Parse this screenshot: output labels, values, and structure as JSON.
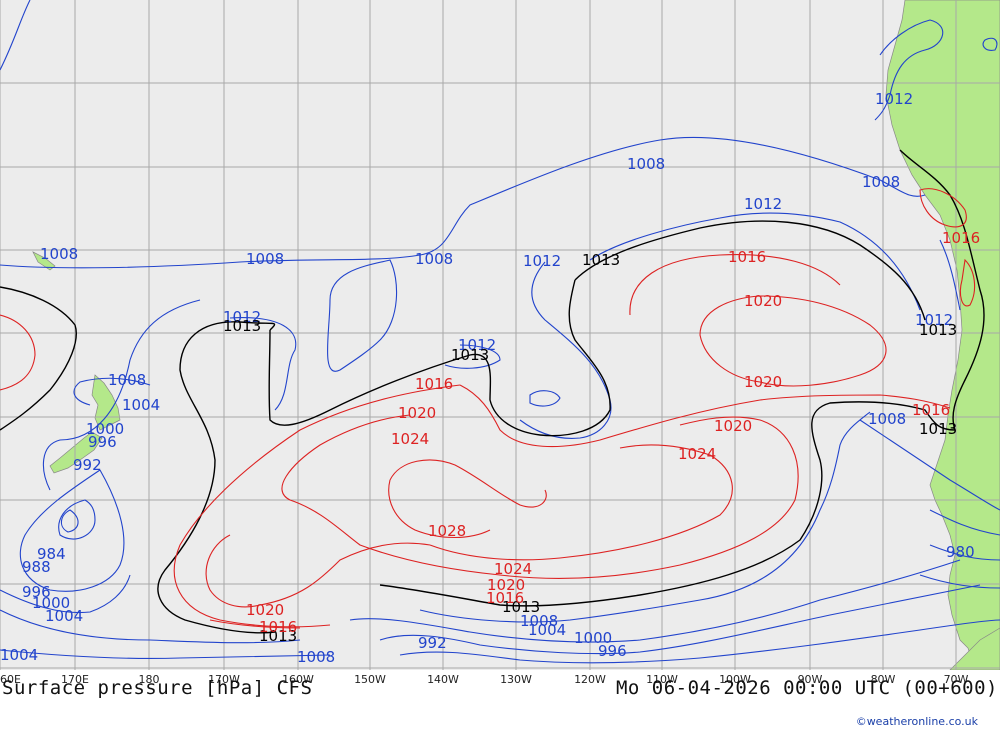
{
  "footer": {
    "title_left": "Surface pressure [hPa] CFS",
    "title_right": "Mo 06-04-2026 00:00 UTC (00+600)",
    "credit": "©weatheronline.co.uk"
  },
  "longitude_labels": [
    "60E",
    "170E",
    "180",
    "170W",
    "160W",
    "150W",
    "140W",
    "130W",
    "120W",
    "110W",
    "100W",
    "90W",
    "80W",
    "70W"
  ],
  "isobar_labels": {
    "blue": [
      "1008",
      "1008",
      "1008",
      "1008",
      "1008",
      "1008",
      "1008",
      "1008",
      "1008",
      "1012",
      "1012",
      "1012",
      "1012",
      "1012",
      "1012",
      "1004",
      "1004",
      "1004",
      "1004",
      "1000",
      "1000",
      "1000",
      "996",
      "996",
      "996",
      "992",
      "992",
      "988",
      "984",
      "980"
    ],
    "black": [
      "1013",
      "1013",
      "1013",
      "1013",
      "1013",
      "1013",
      "1013"
    ],
    "red": [
      "1016",
      "1016",
      "1016",
      "1016",
      "1016",
      "1016",
      "1020",
      "1020",
      "1020",
      "1020",
      "1020",
      "1020",
      "1024",
      "1024",
      "1024",
      "1028"
    ]
  },
  "colors": {
    "ocean": "#ececec",
    "land": "#b4e88a",
    "grid": "#a8a8a8",
    "isobar_low": "#2244cc",
    "isobar_standard": "#000000",
    "isobar_high": "#dd2222"
  }
}
